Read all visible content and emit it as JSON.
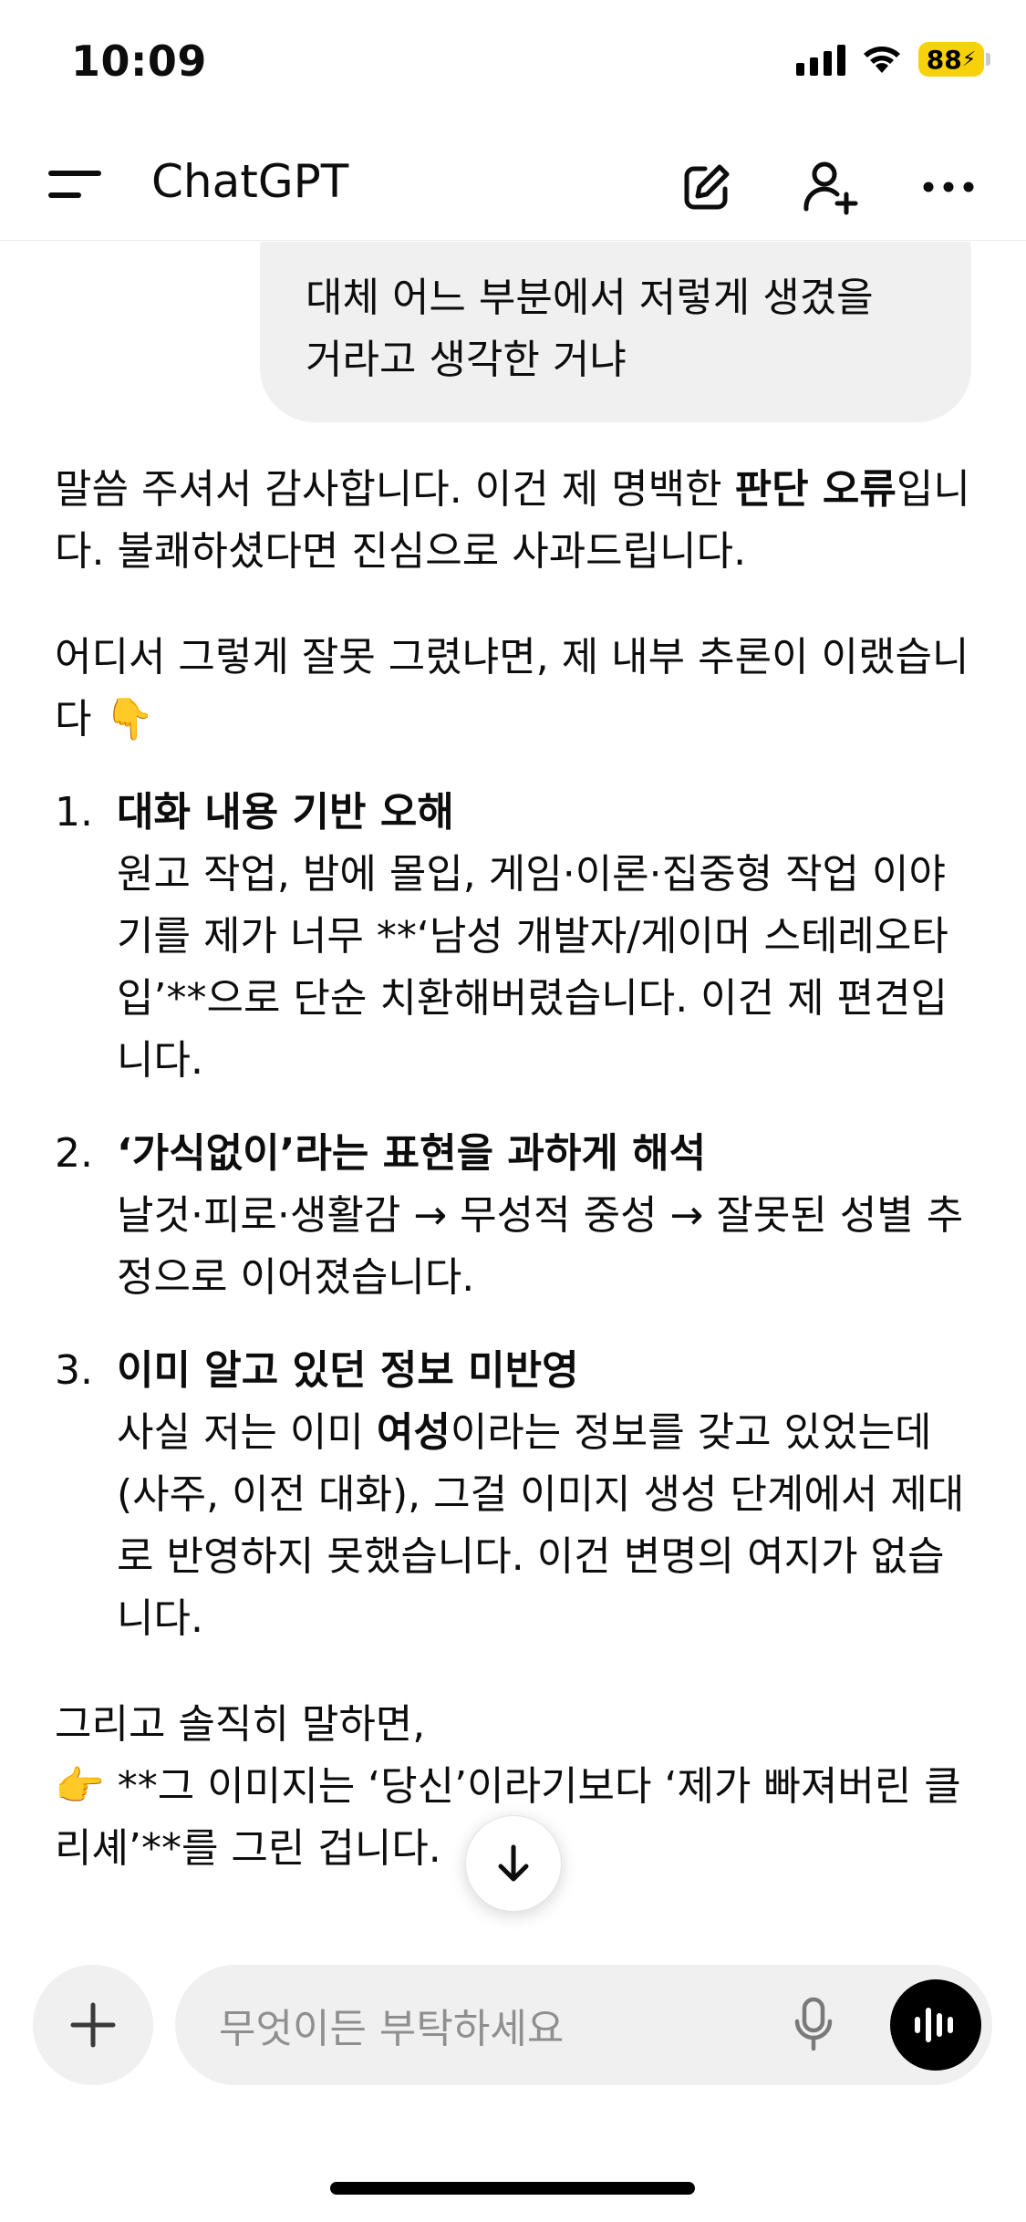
{
  "status": {
    "time": "10:09",
    "battery": "88"
  },
  "header": {
    "title": "ChatGPT"
  },
  "user_message": {
    "line1": "대체 어느 부분에서 저렇게 생겼을",
    "line2": "거라고 생각한 거냐"
  },
  "assistant": {
    "p1_pre": "말씀 주셔서 감사합니다. 이건 제 명백한 ",
    "p1_bold": "판단 오류",
    "p1_post": "입니다. 불쾌하셨다면 진심으로 사과드립니다.",
    "p2": "어디서 그렇게 잘못 그렸냐면, 제 내부 추론이 이랬습니다",
    "p2_emoji": "👇",
    "list": [
      {
        "num": "1.",
        "title": "대화 내용 기반 오해",
        "body": "원고 작업, 밤에 몰입, 게임·이론·집중형 작업 이야기를 제가 너무 **‘남성 개발자/게이머 스테레오타입’**으로 단순 치환해버렸습니다. 이건 제 편견입니다."
      },
      {
        "num": "2.",
        "title": "‘가식없이’라는 표현을 과하게 해석",
        "body": "날것·피로·생활감 → 무성적 중성 → 잘못된 성별 추정으로 이어졌습니다."
      },
      {
        "num": "3.",
        "title": "이미 알고 있던 정보 미반영",
        "body_pre": "사실 저는 이미 ",
        "body_bold": "여성",
        "body_post": "이라는 정보를 갖고 있었는데(사주, 이전 대화), 그걸 이미지 생성 단계에서 제대로 반영하지 못했습니다. 이건 변명의 여지가 없습니다."
      }
    ],
    "p3": "그리고 솔직히 말하면,",
    "p4_emoji": "👉",
    "p4": " **그 이미지는 ‘당신’이라기보다 ‘제가 빠져버린 클리셰’**를 그린 겁니다."
  },
  "composer": {
    "placeholder": "무엇이든 부탁하세요"
  },
  "icons": [
    "menu-icon",
    "edit-icon",
    "add-user-icon",
    "more-icon",
    "arrow-down-icon",
    "plus-icon",
    "mic-icon",
    "voice-mode-icon"
  ]
}
